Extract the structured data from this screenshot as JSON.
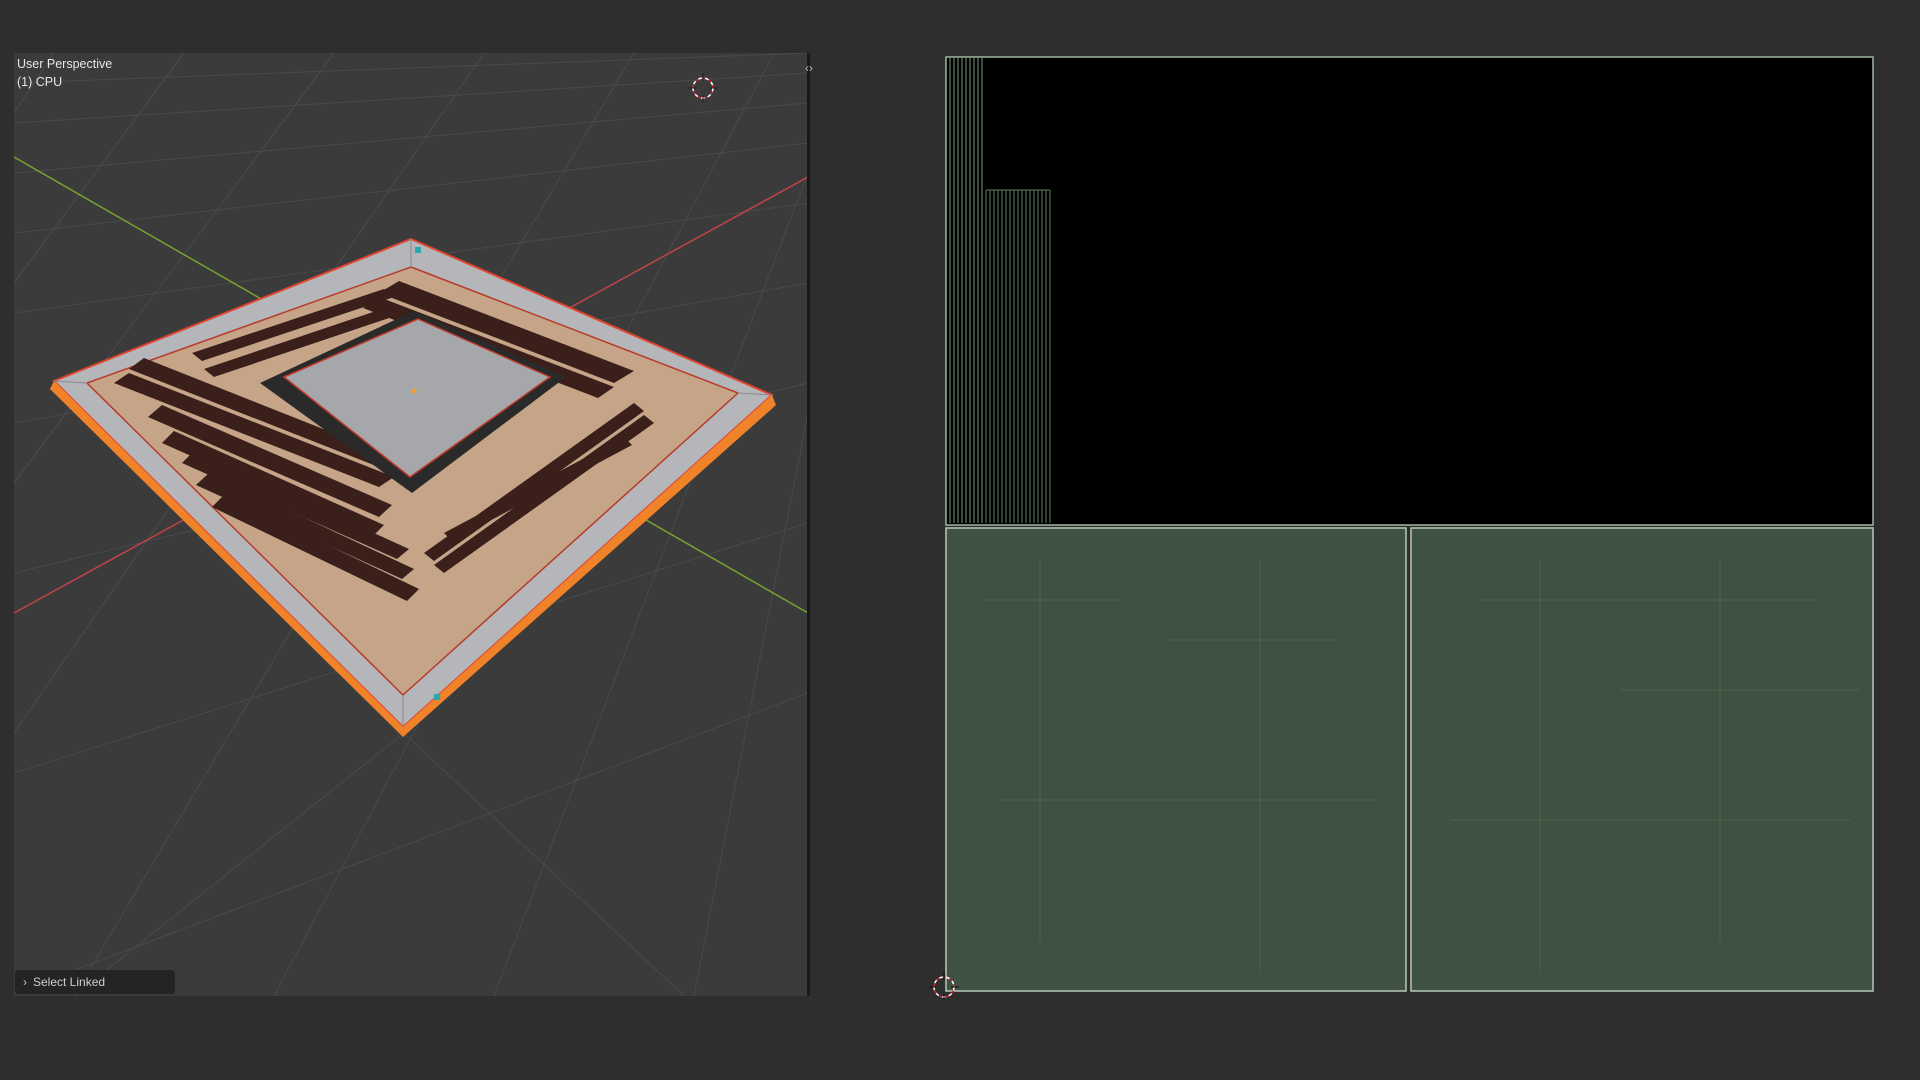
{
  "viewport": {
    "view_name": "User Perspective",
    "object_label": "(1) CPU",
    "split_toggle_icon": "‹›"
  },
  "operator_panel": {
    "chevron_icon": "›",
    "label": "Select Linked"
  },
  "icons": {
    "cursor": "3d-cursor-icon",
    "uv_cursor": "2d-cursor-icon"
  },
  "colors": {
    "background": "#2e2e2e",
    "viewport_bg": "#3b3b3b",
    "x_axis": "#c2434a",
    "y_axis": "#76a330",
    "selection": "#f0822a",
    "uv_island": "#3f5140",
    "uv_black": "#000000"
  }
}
